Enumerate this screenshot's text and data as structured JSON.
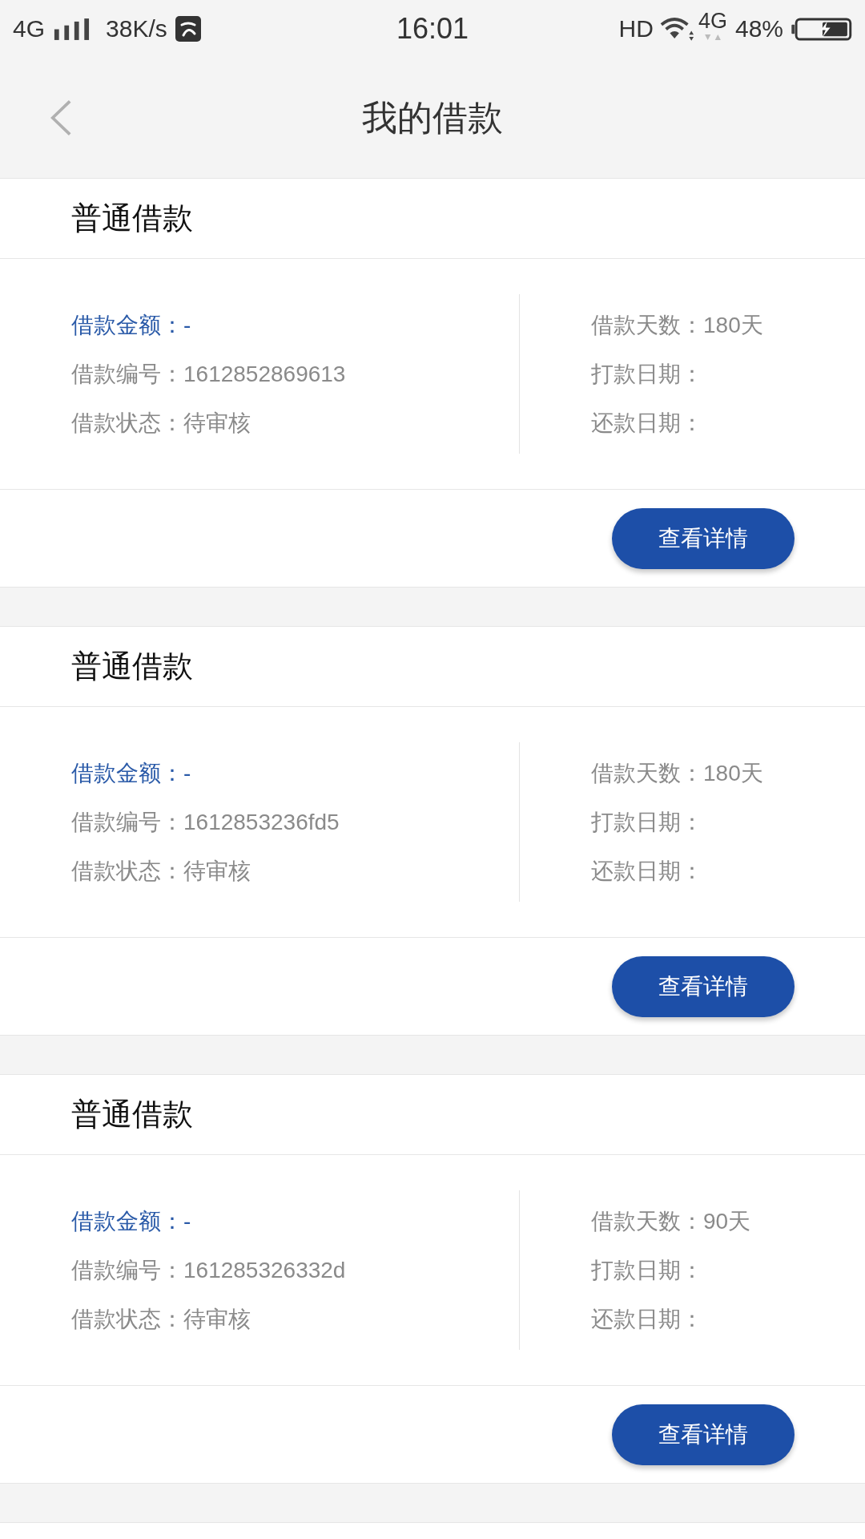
{
  "status_bar": {
    "network": "4G",
    "speed": "38K/s",
    "time": "16:01",
    "hd": "HD",
    "network_right": "4G",
    "battery": "48%"
  },
  "header": {
    "title": "我的借款"
  },
  "loans": [
    {
      "title": "普通借款",
      "left_fields": [
        {
          "text": "借款金额：-",
          "highlighted": true
        },
        {
          "text": "借款编号：1612852869613",
          "highlighted": false
        },
        {
          "text": "借款状态：待审核",
          "highlighted": false
        }
      ],
      "right_fields": [
        {
          "text": "借款天数：180天",
          "highlighted": false
        },
        {
          "text": "打款日期：",
          "highlighted": false
        },
        {
          "text": "还款日期：",
          "highlighted": false
        }
      ],
      "button": "查看详情"
    },
    {
      "title": "普通借款",
      "left_fields": [
        {
          "text": "借款金额：-",
          "highlighted": true
        },
        {
          "text": "借款编号：1612853236fd5",
          "highlighted": false
        },
        {
          "text": "借款状态：待审核",
          "highlighted": false
        }
      ],
      "right_fields": [
        {
          "text": "借款天数：180天",
          "highlighted": false
        },
        {
          "text": "打款日期：",
          "highlighted": false
        },
        {
          "text": "还款日期：",
          "highlighted": false
        }
      ],
      "button": "查看详情"
    },
    {
      "title": "普通借款",
      "left_fields": [
        {
          "text": "借款金额：-",
          "highlighted": true
        },
        {
          "text": "借款编号：161285326332d",
          "highlighted": false
        },
        {
          "text": "借款状态：待审核",
          "highlighted": false
        }
      ],
      "right_fields": [
        {
          "text": "借款天数：90天",
          "highlighted": false
        },
        {
          "text": "打款日期：",
          "highlighted": false
        },
        {
          "text": "还款日期：",
          "highlighted": false
        }
      ],
      "button": "查看详情"
    }
  ]
}
